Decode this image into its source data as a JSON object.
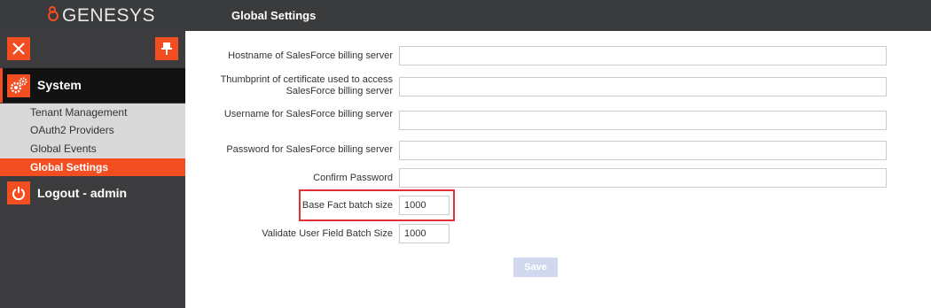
{
  "header": {
    "brand": "GENESYS",
    "title": "Global Settings"
  },
  "sidebar": {
    "system_label": "System",
    "items": [
      {
        "label": "Tenant Management",
        "active": false
      },
      {
        "label": "OAuth2 Providers",
        "active": false
      },
      {
        "label": "Global Events",
        "active": false
      },
      {
        "label": "Global Settings",
        "active": true
      }
    ],
    "logout_label": "Logout - admin"
  },
  "form": {
    "hostname": {
      "label": "Hostname of SalesForce billing server",
      "value": ""
    },
    "thumbprint": {
      "label": "Thumbprint of certificate used to access SalesForce billing server",
      "value": ""
    },
    "username": {
      "label": "Username for SalesForce billing server",
      "value": ""
    },
    "password": {
      "label": "Password for SalesForce billing server",
      "value": ""
    },
    "confirm_password": {
      "label": "Confirm Password",
      "value": ""
    },
    "base_fact_batch": {
      "label": "Base Fact batch size",
      "value": "1000"
    },
    "validate_user_batch": {
      "label": "Validate User Field Batch Size",
      "value": "1000"
    },
    "save_label": "Save"
  },
  "colors": {
    "accent": "#f34e22",
    "topbar": "#3a3b3d",
    "highlight": "#e0313a"
  }
}
